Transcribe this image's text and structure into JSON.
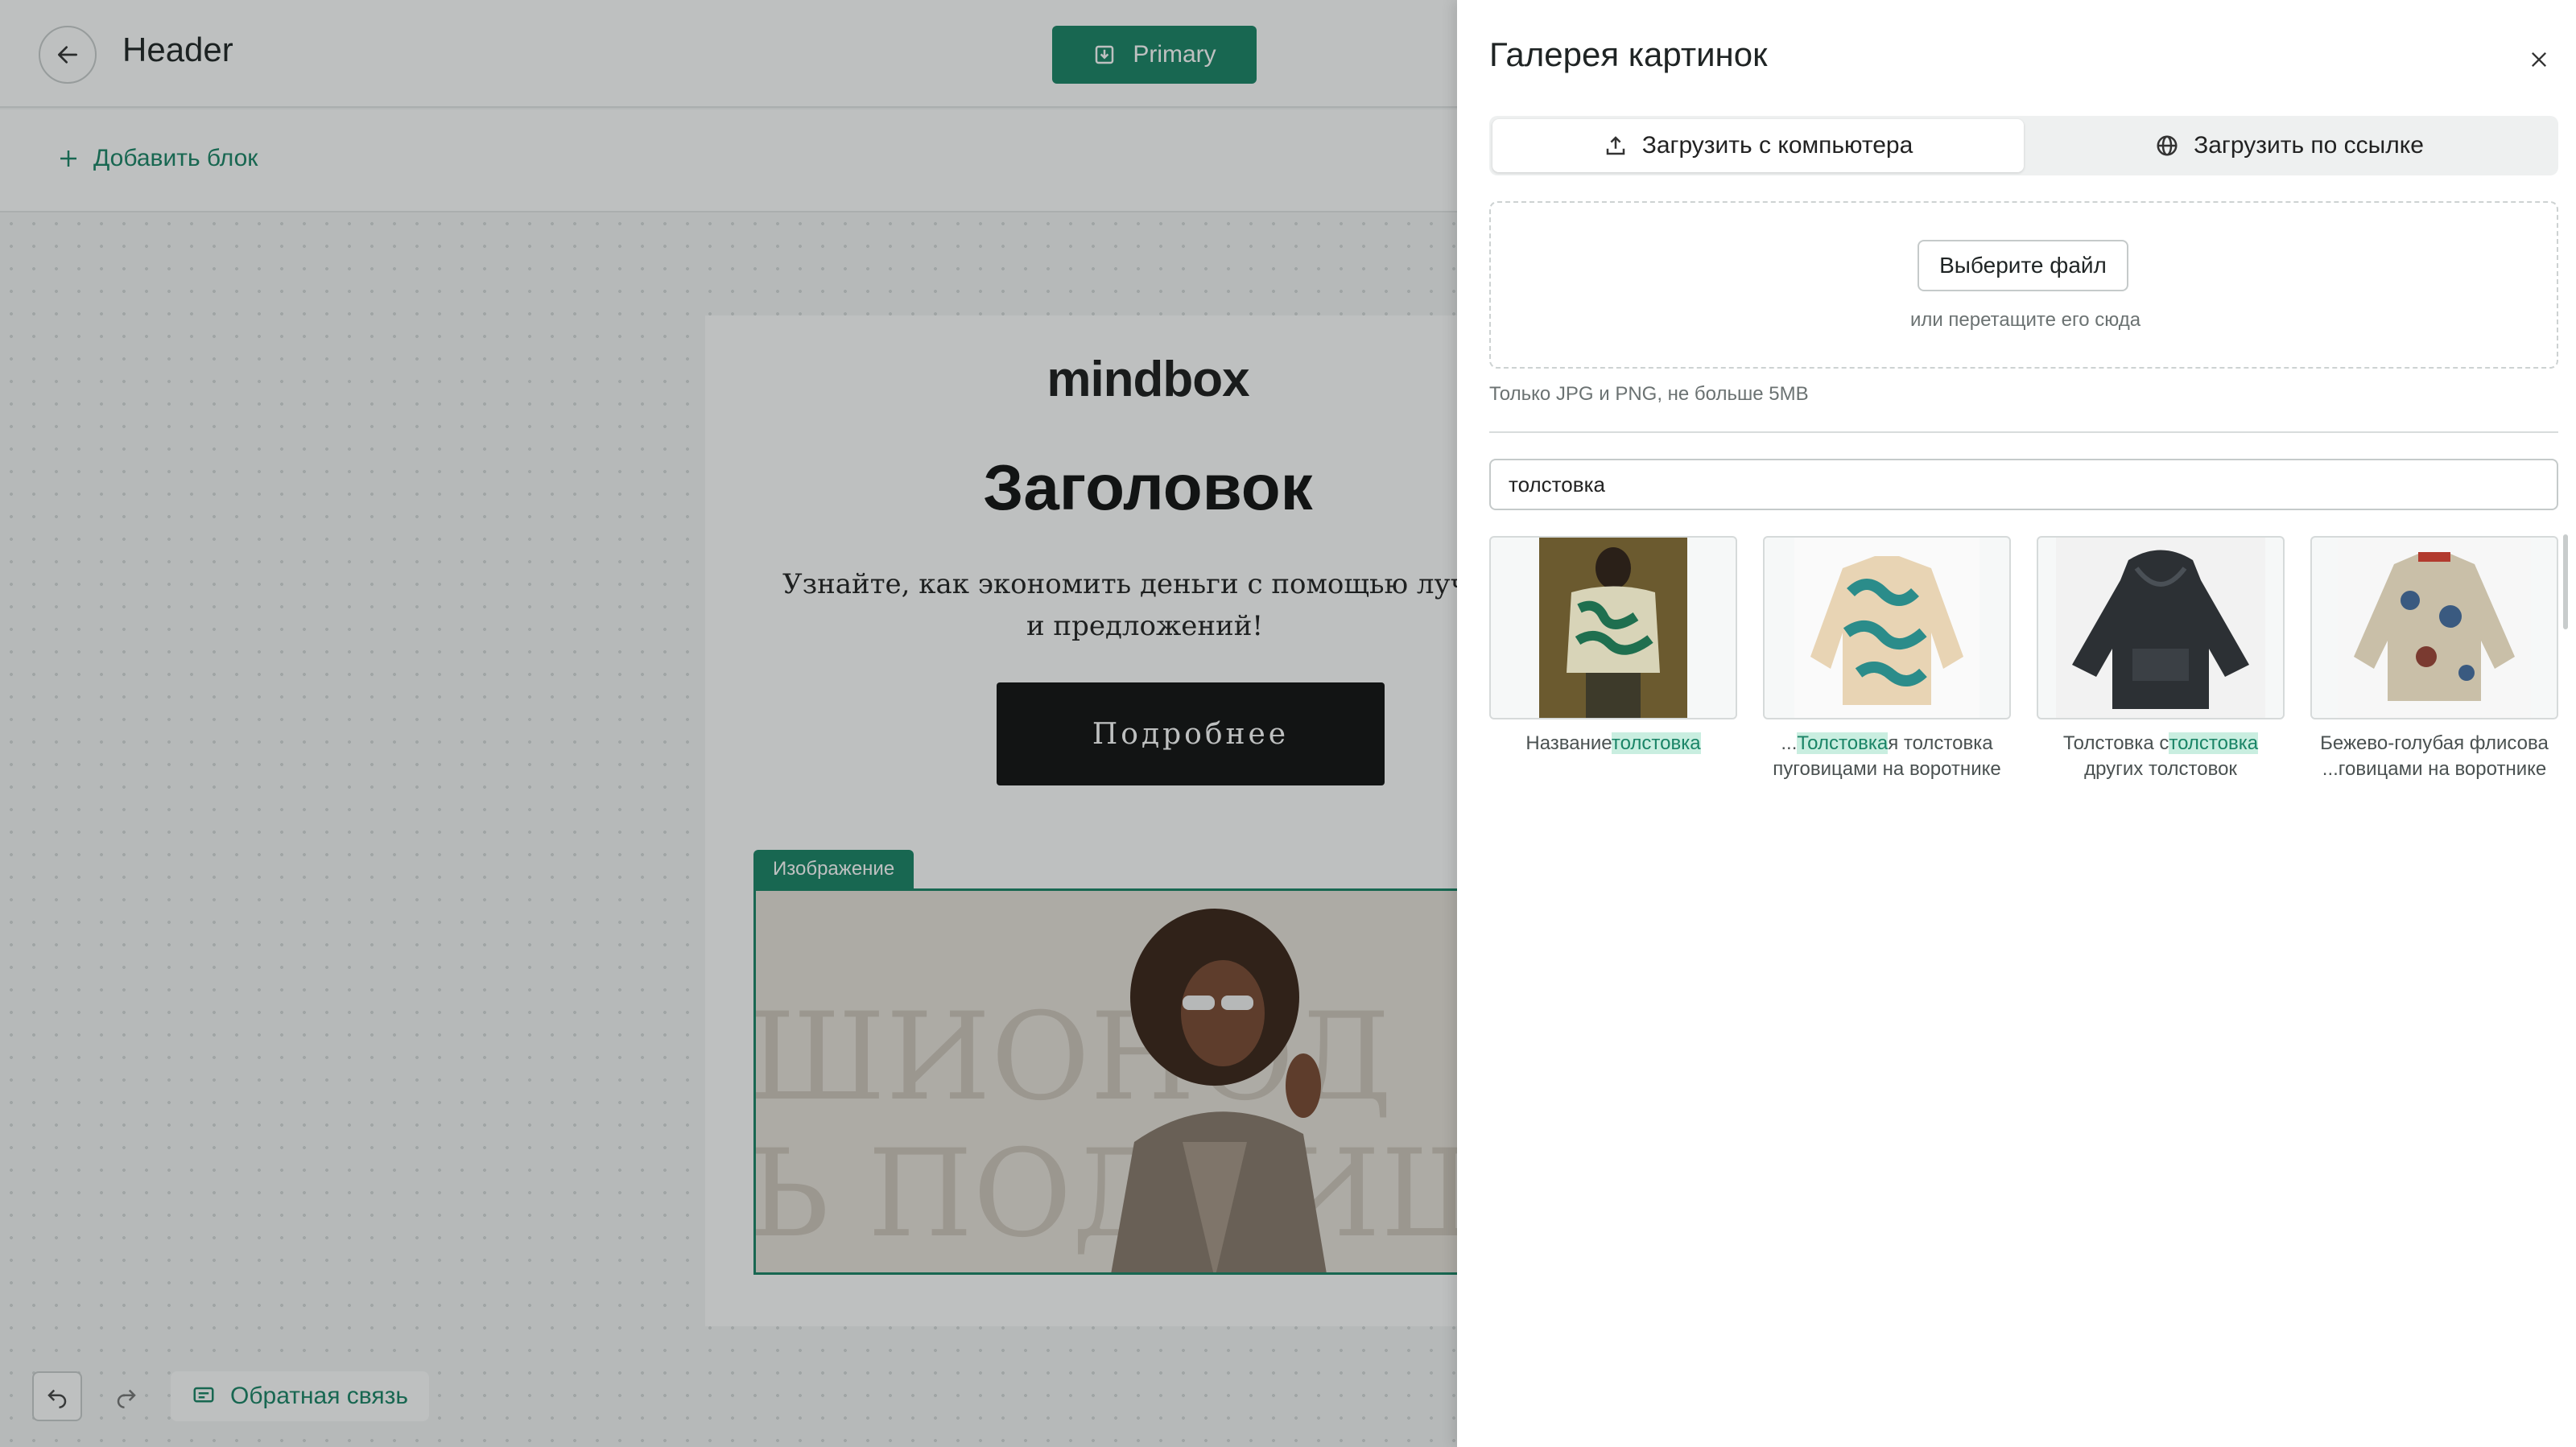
{
  "editor": {
    "title": "Header",
    "primary_label": "Primary",
    "add_block_label": "Добавить блок",
    "feedback_label": "Обратная связь"
  },
  "email": {
    "logo": "mindbox",
    "headline": "Заголовок",
    "lead_line1": "Узнайте, как экономить деньги с помощью лучш",
    "lead_line2": "и предложений!",
    "cta_label": "Подробнее",
    "image_tag": "Изображение",
    "bg_line1": "ШИОНОД",
    "bg_line2": "Ь ПОДПИШИ"
  },
  "gallery": {
    "title": "Галерея картинок",
    "tab_upload_label": "Загрузить с компьютера",
    "tab_link_label": "Загрузить по ссылке",
    "choose_file_label": "Выберите файл",
    "drop_hint": "или перетащите его сюда",
    "file_hint": "Только JPG и PNG, не больше 5MB",
    "search_value": "толстовка",
    "items": [
      {
        "caption_pre": "Название",
        "caption_hl": "толстовка",
        "caption_post": "",
        "caption_line2": ""
      },
      {
        "caption_pre": "...",
        "caption_hl": "Толстовка",
        "caption_post": "я толстовка",
        "caption_line2": "пуговицами на воротнике"
      },
      {
        "caption_pre": "Толстовка с",
        "caption_hl": "толстовка",
        "caption_post": "",
        "caption_line2": "других толстовок"
      },
      {
        "caption_pre": "Бежево-голубая флисова",
        "caption_hl": "",
        "caption_post": "",
        "caption_line2": "...говицами на воротнике"
      }
    ]
  },
  "colors": {
    "accent": "#1a8466",
    "highlight": "#c9eee0"
  }
}
